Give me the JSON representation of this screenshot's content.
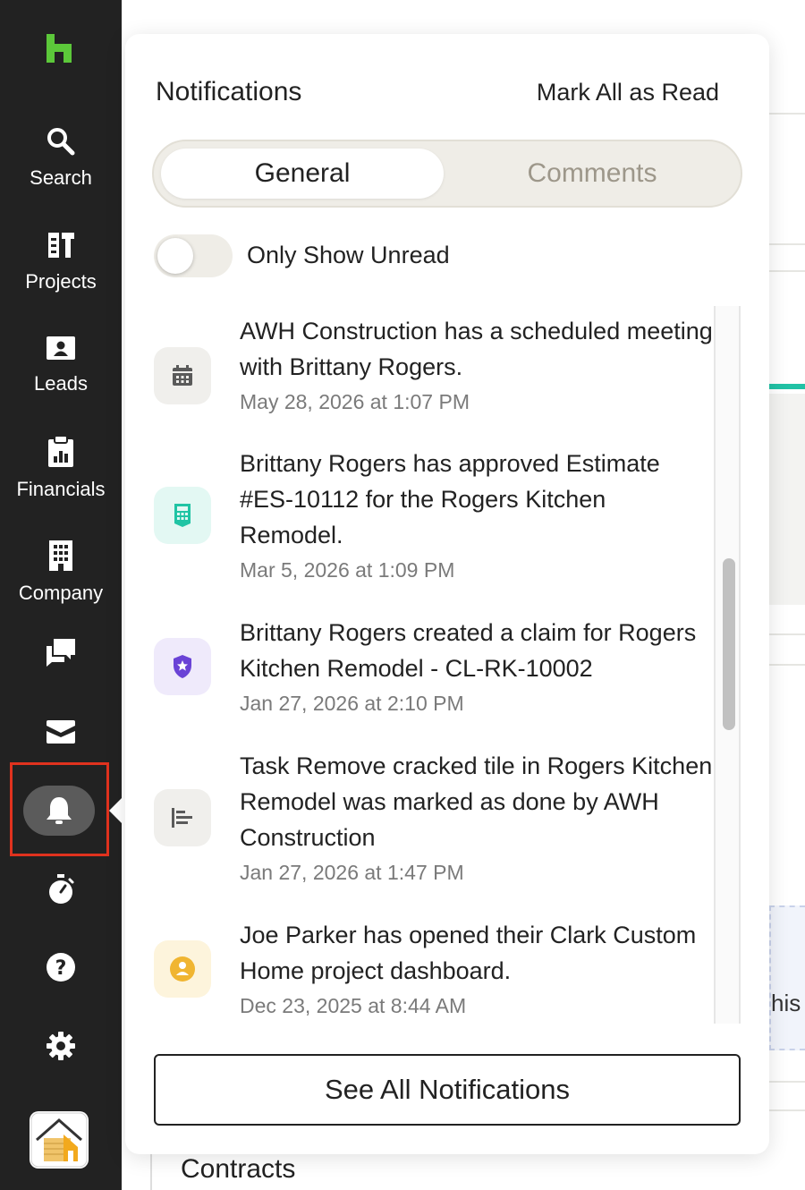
{
  "sidebar": {
    "items": [
      {
        "label": "Search",
        "icon": "search-icon"
      },
      {
        "label": "Projects",
        "icon": "projects-icon"
      },
      {
        "label": "Leads",
        "icon": "leads-icon"
      },
      {
        "label": "Financials",
        "icon": "financials-icon"
      },
      {
        "label": "Company",
        "icon": "company-icon"
      }
    ],
    "icons_only": [
      "messages-icon",
      "inbox-icon",
      "bell-icon",
      "timer-icon",
      "help-icon",
      "gear-icon"
    ],
    "brand_color": "#5cc83a",
    "bg_color": "#222222"
  },
  "notifications": {
    "title": "Notifications",
    "mark_all_label": "Mark All as Read",
    "tabs": [
      {
        "label": "General",
        "active": true
      },
      {
        "label": "Comments",
        "active": false
      }
    ],
    "toggle_label": "Only Show Unread",
    "items": [
      {
        "message": "AWH Construction has a scheduled meeting with Brittany Rogers.",
        "time": "May 28, 2026 at 1:07 PM",
        "icon": "calendar-icon",
        "icon_bg": "#f0efec",
        "icon_color": "#5a5a5a"
      },
      {
        "message": "Brittany Rogers has approved Estimate #ES-10112 for the Rogers Kitchen Remodel.",
        "time": "Mar 5, 2026 at 1:09 PM",
        "icon": "calculator-icon",
        "icon_bg": "#e3f8f3",
        "icon_color": "#20c4a4"
      },
      {
        "message": "Brittany Rogers created a claim for Rogers Kitchen Remodel - CL-RK-10002",
        "time": "Jan 27, 2026 at 2:10 PM",
        "icon": "shield-star-icon",
        "icon_bg": "#efeafb",
        "icon_color": "#6a43d6"
      },
      {
        "message": "Task Remove cracked tile in Rogers Kitchen Remodel was marked as done by AWH Construction",
        "time": "Jan 27, 2026 at 1:47 PM",
        "icon": "task-icon",
        "icon_bg": "#f0efec",
        "icon_color": "#5a5a5a"
      },
      {
        "message": "Joe Parker has opened their Clark Custom Home project dashboard.",
        "time": "Dec 23, 2025 at 8:44 AM",
        "icon": "client-icon",
        "icon_bg": "#fdf4dc",
        "icon_color": "#f0b531"
      }
    ],
    "see_all_label": "See All Notifications"
  },
  "background": {
    "partial_text": "his",
    "section_title": "Contracts"
  }
}
